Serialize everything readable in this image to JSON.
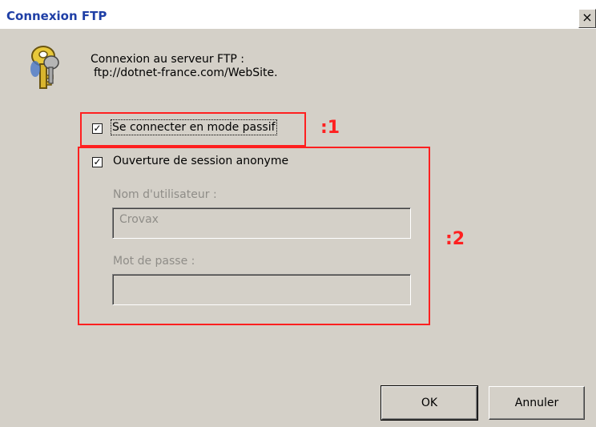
{
  "window": {
    "title": "Connexion FTP",
    "close_glyph": "×"
  },
  "message": {
    "line1": "Connexion au serveur FTP :",
    "line2": "ftp://dotnet-france.com/WebSite."
  },
  "passive_mode": {
    "label": "Se connecter en mode passif",
    "checked": true
  },
  "anonymous_login": {
    "label": "Ouverture de session anonyme",
    "checked": true
  },
  "username": {
    "label": "Nom d'utilisateur :",
    "value": "Crovax"
  },
  "password": {
    "label": "Mot de passe :",
    "value": ""
  },
  "annotations": {
    "label1": ":1",
    "label2": ":2",
    "color": "#ff2020"
  },
  "buttons": {
    "ok": "OK",
    "cancel": "Annuler"
  },
  "icons": {
    "dialog_icon": "key-icon",
    "check": "✓"
  }
}
